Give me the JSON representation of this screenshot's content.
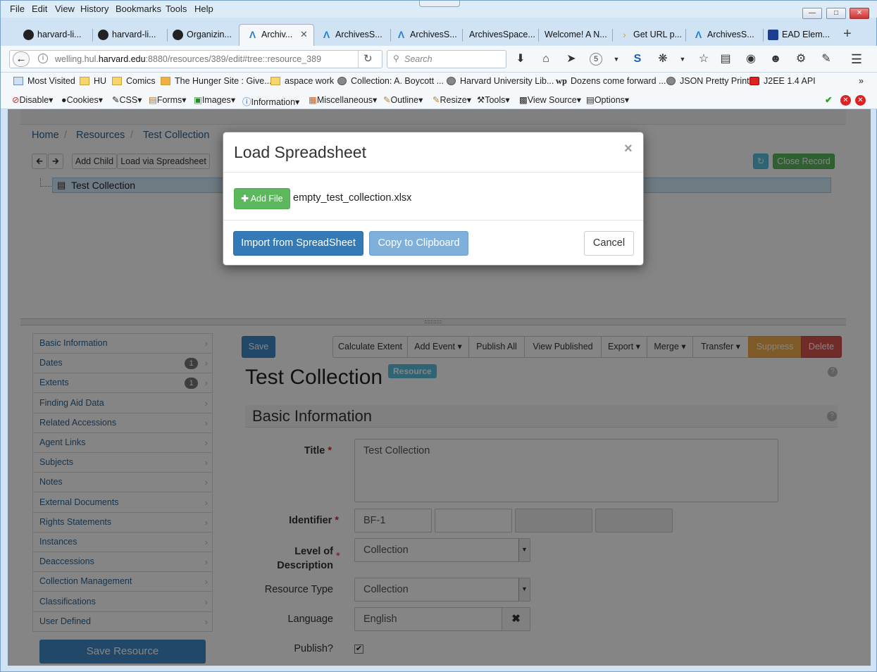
{
  "menu": [
    "File",
    "Edit",
    "View",
    "History",
    "Bookmarks",
    "Tools",
    "Help"
  ],
  "tabs": [
    {
      "label": "harvard-li...",
      "icon": "github"
    },
    {
      "label": "harvard-li...",
      "icon": "github"
    },
    {
      "label": "Organizin...",
      "icon": "github"
    },
    {
      "label": "Archiv...",
      "icon": "archivesspace"
    },
    {
      "label": "ArchivesS...",
      "icon": "archivesspace"
    },
    {
      "label": "ArchivesS...",
      "icon": "archivesspace"
    },
    {
      "label": "ArchivesSpace...",
      "icon": "none"
    },
    {
      "label": "Welcome! A N...",
      "icon": "none"
    },
    {
      "label": "Get URL p...",
      "icon": "arrow"
    },
    {
      "label": "ArchivesS...",
      "icon": "archivesspace"
    },
    {
      "label": "EAD Elem...",
      "icon": "library"
    }
  ],
  "url": {
    "prefix": "welling.hul.",
    "domain": "harvard.edu",
    "suffix": ":8880/resources/389/edit#tree::resource_389"
  },
  "search_placeholder": "Search",
  "badge_count": "5",
  "bookmarks": [
    "Most Visited",
    "HU",
    "Comics",
    "The Hunger Site : Give...",
    "aspace work",
    "Collection: A. Boycott ...",
    "Harvard University Lib...",
    "Dozens come forward ...",
    "JSON Pretty Print",
    "J2EE 1.4 API"
  ],
  "webdev": [
    "Disable",
    "Cookies",
    "CSS",
    "Forms",
    "Images",
    "Information",
    "Miscellaneous",
    "Outline",
    "Resize",
    "Tools",
    "View Source",
    "Options"
  ],
  "breadcrumb": [
    "Home",
    "Resources",
    "Test Collection"
  ],
  "tree": {
    "add_child": "Add Child",
    "load_spreadsheet": "Load via Spreadsheet",
    "node": "Test Collection",
    "close_record": "Close Record"
  },
  "sidebar": [
    {
      "label": "Basic Information",
      "count": ""
    },
    {
      "label": "Dates",
      "count": "1"
    },
    {
      "label": "Extents",
      "count": "1"
    },
    {
      "label": "Finding Aid Data",
      "count": ""
    },
    {
      "label": "Related Accessions",
      "count": ""
    },
    {
      "label": "Agent Links",
      "count": ""
    },
    {
      "label": "Subjects",
      "count": ""
    },
    {
      "label": "Notes",
      "count": ""
    },
    {
      "label": "External Documents",
      "count": ""
    },
    {
      "label": "Rights Statements",
      "count": ""
    },
    {
      "label": "Instances",
      "count": ""
    },
    {
      "label": "Deaccessions",
      "count": ""
    },
    {
      "label": "Collection Management",
      "count": ""
    },
    {
      "label": "Classifications",
      "count": ""
    },
    {
      "label": "User Defined",
      "count": ""
    }
  ],
  "save_resource": "Save Resource",
  "toolbar": {
    "save": "Save",
    "calculate_extent": "Calculate Extent",
    "add_event": "Add Event",
    "publish_all": "Publish All",
    "view_published": "View Published",
    "export": "Export",
    "merge": "Merge",
    "transfer": "Transfer",
    "suppress": "Suppress",
    "delete": "Delete"
  },
  "record": {
    "title": "Test Collection",
    "type_badge": "Resource",
    "section": "Basic Information"
  },
  "form": {
    "title_label": "Title",
    "title_value": "Test Collection",
    "identifier_label": "Identifier",
    "identifier_value": "BF-1",
    "level_label_1": "Level of",
    "level_label_2": "Description",
    "level_value": "Collection",
    "resource_type_label": "Resource Type",
    "resource_type_value": "Collection",
    "language_label": "Language",
    "language_value": "English",
    "publish_label": "Publish?"
  },
  "modal": {
    "title": "Load Spreadsheet",
    "add_file": "Add File",
    "filename": "empty_test_collection.xlsx",
    "import": "Import from SpreadSheet",
    "copy": "Copy to Clipboard",
    "cancel": "Cancel"
  }
}
